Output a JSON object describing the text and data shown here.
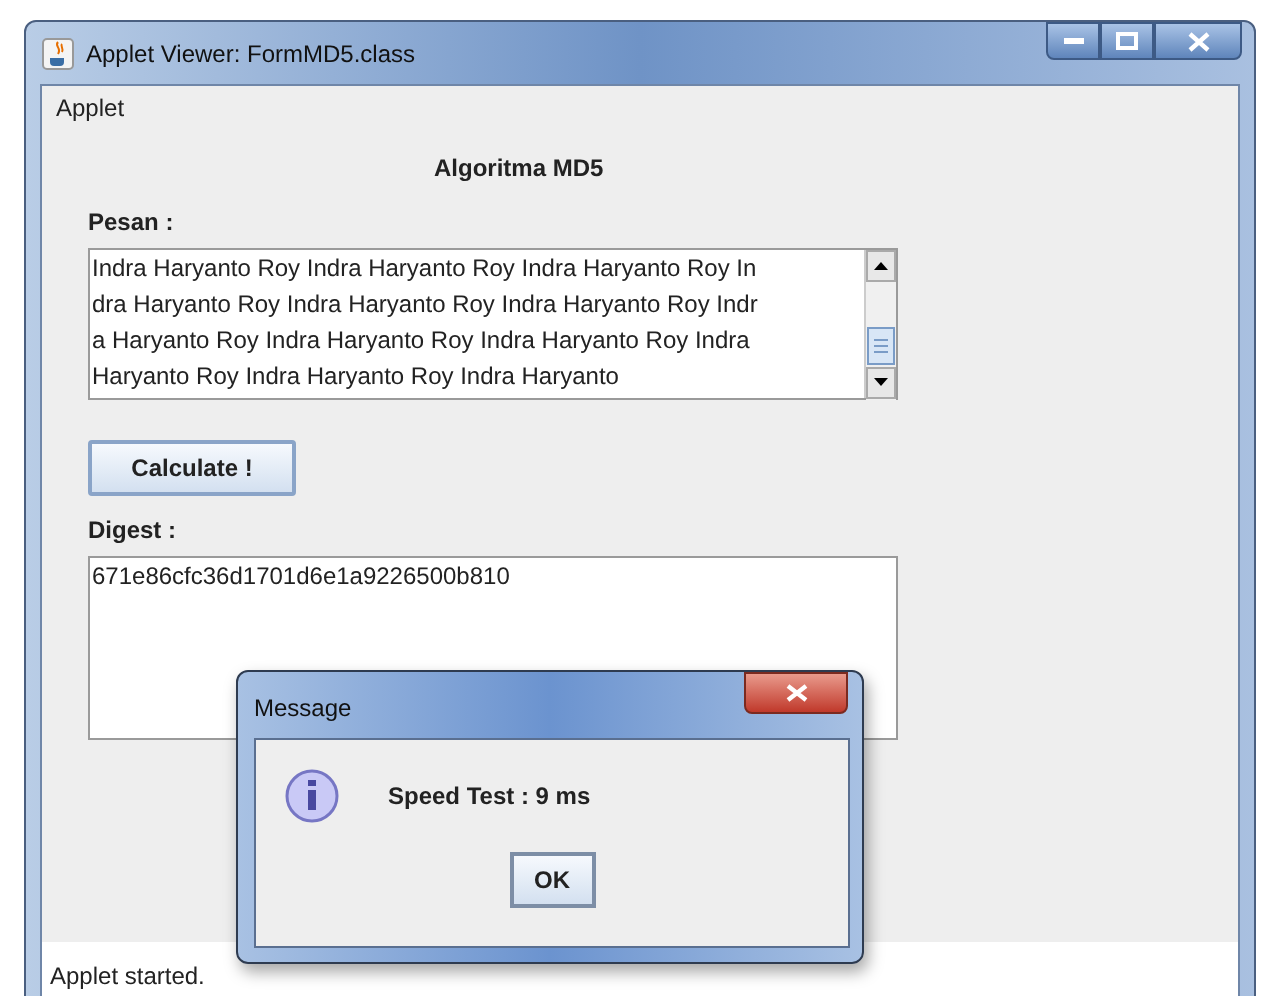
{
  "window": {
    "title": "Applet Viewer: FormMD5.class"
  },
  "menu": [
    "Applet"
  ],
  "heading": "Algoritma MD5",
  "message_label": "Pesan :",
  "message_lines": [
    "Indra Haryanto Roy Indra Haryanto Roy Indra Haryanto Roy In",
    "dra Haryanto Roy Indra Haryanto Roy Indra Haryanto Roy Indr",
    "a Haryanto Roy Indra Haryanto Roy Indra Haryanto Roy Indra",
    "Haryanto Roy Indra Haryanto Roy Indra Haryanto"
  ],
  "calculate_button": "Calculate !",
  "digest_label": "Digest :",
  "digest_value": "671e86cfc36d1701d6e1a9226500b810",
  "status_bar": "Applet started.",
  "dialog": {
    "title": "Message",
    "text": "Speed Test : 9 ms",
    "button": "OK"
  }
}
